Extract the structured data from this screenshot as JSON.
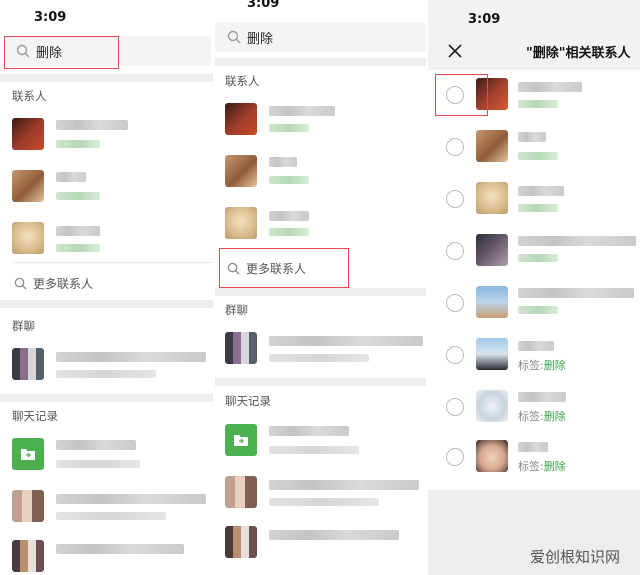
{
  "status": {
    "time": "3:09"
  },
  "panel1": {
    "search_text": "删除",
    "contacts_title": "联系人",
    "more_contacts": "更多联系人",
    "groups_title": "群聊",
    "chat_title": "聊天记录"
  },
  "panel2": {
    "search_text": "删除",
    "contacts_title": "联系人",
    "more_contacts": "更多联系人",
    "groups_title": "群聊",
    "chat_title": "聊天记录"
  },
  "panel3": {
    "title": "\"删除\"相关联系人",
    "close_icon": "close-icon",
    "tags": [
      {
        "label": "标签:",
        "value": "删除"
      },
      {
        "label": "标签:",
        "value": "删除"
      },
      {
        "label": "标签:",
        "value": "删除"
      }
    ]
  },
  "watermark": "爱创根知识网",
  "colors": {
    "accent_green": "#3fa34d",
    "highlight_red": "#e24b4b",
    "folder_green": "#4caf50"
  }
}
